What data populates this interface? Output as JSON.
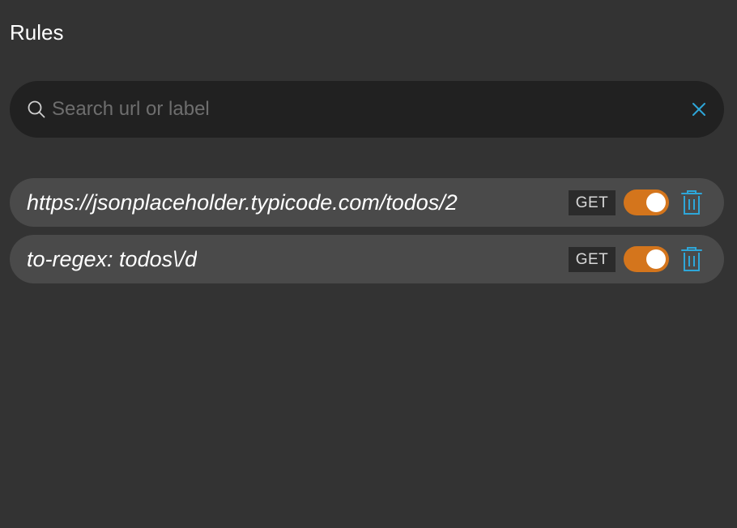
{
  "header": {
    "title": "Rules"
  },
  "search": {
    "placeholder": "Search url or label",
    "value": "",
    "icon": "search-icon",
    "clear_icon": "close-icon"
  },
  "rules": [
    {
      "label": "https://jsonplaceholder.typicode.com/todos/2",
      "method": "GET",
      "enabled": true,
      "delete_icon": "trash-icon"
    },
    {
      "label": "to-regex: todos\\/d",
      "method": "GET",
      "enabled": true,
      "delete_icon": "trash-icon"
    }
  ],
  "colors": {
    "background": "#333333",
    "search_background": "#212121",
    "row_background": "#4a4a4a",
    "toggle_on": "#d4751c",
    "accent_icon": "#2ea6d8",
    "badge_background": "#2b2b2b"
  }
}
